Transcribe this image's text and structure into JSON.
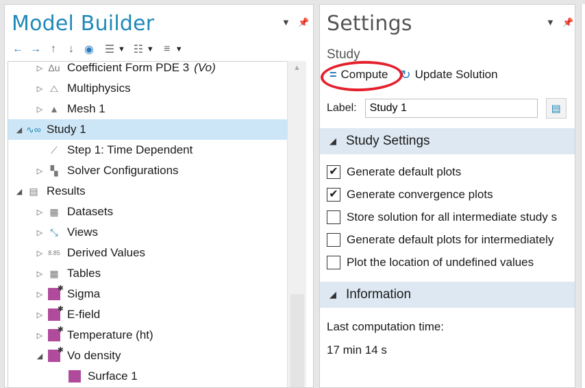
{
  "model_builder": {
    "title": "Model Builder",
    "tree": [
      {
        "label": "Coefficient Form PDE 3",
        "suffix": "(Vo)",
        "icon": "pde-icon",
        "glyph": "Δu",
        "level": 2,
        "twisty": "collapsed"
      },
      {
        "label": "Multiphysics",
        "icon": "multiphysics-icon",
        "glyph": "⧍",
        "level": 2,
        "twisty": "collapsed"
      },
      {
        "label": "Mesh 1",
        "icon": "mesh-icon",
        "glyph": "▲",
        "level": 2,
        "twisty": "collapsed"
      },
      {
        "label": "Study 1",
        "icon": "study-icon",
        "glyph": "∿∞",
        "level": 1,
        "twisty": "expanded",
        "selected": true
      },
      {
        "label": "Step 1: Time Dependent",
        "icon": "time-dependent-icon",
        "glyph": "⟋",
        "level": 2,
        "twisty": "none"
      },
      {
        "label": "Solver Configurations",
        "icon": "solver-icon",
        "glyph": "▚",
        "level": 2,
        "twisty": "collapsed"
      },
      {
        "label": "Results",
        "icon": "results-icon",
        "glyph": "▤",
        "level": 1,
        "twisty": "expanded"
      },
      {
        "label": "Datasets",
        "icon": "datasets-icon",
        "glyph": "▦",
        "level": 2,
        "twisty": "collapsed"
      },
      {
        "label": "Views",
        "icon": "views-icon",
        "glyph": "⤡",
        "level": 2,
        "twisty": "collapsed"
      },
      {
        "label": "Derived Values",
        "icon": "derived-values-icon",
        "glyph": "8.85",
        "level": 2,
        "twisty": "collapsed"
      },
      {
        "label": "Tables",
        "icon": "tables-icon",
        "glyph": "▦",
        "level": 2,
        "twisty": "collapsed"
      },
      {
        "label": "Sigma",
        "icon": "plot-group-icon",
        "glyph": "",
        "level": 2,
        "twisty": "collapsed"
      },
      {
        "label": "E-field",
        "icon": "plot-group-icon",
        "glyph": "",
        "level": 2,
        "twisty": "collapsed"
      },
      {
        "label": "Temperature (ht)",
        "icon": "plot-group-icon",
        "glyph": "",
        "level": 2,
        "twisty": "collapsed"
      },
      {
        "label": "Vo density",
        "icon": "plot-group-icon",
        "glyph": "",
        "level": 2,
        "twisty": "expanded"
      },
      {
        "label": "Surface 1",
        "icon": "surface-plot-icon",
        "glyph": "",
        "level": 3,
        "twisty": "none"
      }
    ]
  },
  "settings": {
    "title": "Settings",
    "subtitle": "Study",
    "compute_label": "Compute",
    "update_label": "Update Solution",
    "label_caption": "Label:",
    "label_value": "Study 1",
    "study_settings": {
      "header": "Study Settings",
      "options": [
        {
          "label": "Generate default plots",
          "checked": true
        },
        {
          "label": "Generate convergence plots",
          "checked": true
        },
        {
          "label": "Store solution for all intermediate study s",
          "checked": false
        },
        {
          "label": "Generate default plots for intermediately",
          "checked": false
        },
        {
          "label": "Plot the location of undefined values",
          "checked": false
        }
      ]
    },
    "information": {
      "header": "Information",
      "last_time_label": "Last computation time:",
      "last_time_value": "17 min 14 s"
    }
  },
  "colors": {
    "accent": "#1f89b8",
    "selection": "#cde6f7",
    "section": "#dde8f2",
    "annotation": "#e3202c",
    "plot_group": "#b04b9c"
  }
}
